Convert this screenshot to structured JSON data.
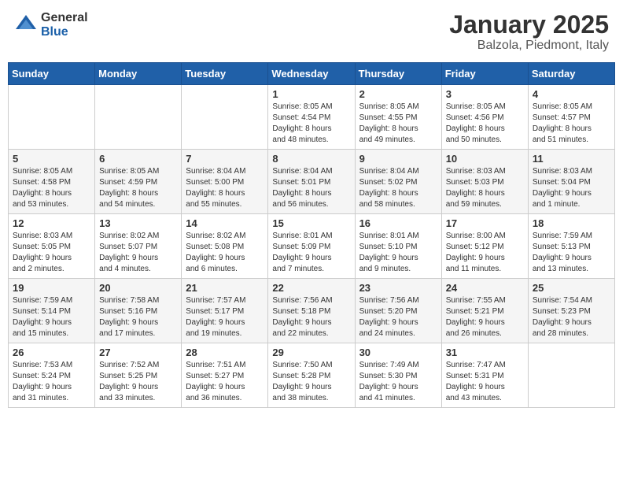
{
  "header": {
    "logo_general": "General",
    "logo_blue": "Blue",
    "month_title": "January 2025",
    "location": "Balzola, Piedmont, Italy"
  },
  "weekdays": [
    "Sunday",
    "Monday",
    "Tuesday",
    "Wednesday",
    "Thursday",
    "Friday",
    "Saturday"
  ],
  "weeks": [
    [
      {
        "day": "",
        "info": ""
      },
      {
        "day": "",
        "info": ""
      },
      {
        "day": "",
        "info": ""
      },
      {
        "day": "1",
        "info": "Sunrise: 8:05 AM\nSunset: 4:54 PM\nDaylight: 8 hours\nand 48 minutes."
      },
      {
        "day": "2",
        "info": "Sunrise: 8:05 AM\nSunset: 4:55 PM\nDaylight: 8 hours\nand 49 minutes."
      },
      {
        "day": "3",
        "info": "Sunrise: 8:05 AM\nSunset: 4:56 PM\nDaylight: 8 hours\nand 50 minutes."
      },
      {
        "day": "4",
        "info": "Sunrise: 8:05 AM\nSunset: 4:57 PM\nDaylight: 8 hours\nand 51 minutes."
      }
    ],
    [
      {
        "day": "5",
        "info": "Sunrise: 8:05 AM\nSunset: 4:58 PM\nDaylight: 8 hours\nand 53 minutes."
      },
      {
        "day": "6",
        "info": "Sunrise: 8:05 AM\nSunset: 4:59 PM\nDaylight: 8 hours\nand 54 minutes."
      },
      {
        "day": "7",
        "info": "Sunrise: 8:04 AM\nSunset: 5:00 PM\nDaylight: 8 hours\nand 55 minutes."
      },
      {
        "day": "8",
        "info": "Sunrise: 8:04 AM\nSunset: 5:01 PM\nDaylight: 8 hours\nand 56 minutes."
      },
      {
        "day": "9",
        "info": "Sunrise: 8:04 AM\nSunset: 5:02 PM\nDaylight: 8 hours\nand 58 minutes."
      },
      {
        "day": "10",
        "info": "Sunrise: 8:03 AM\nSunset: 5:03 PM\nDaylight: 8 hours\nand 59 minutes."
      },
      {
        "day": "11",
        "info": "Sunrise: 8:03 AM\nSunset: 5:04 PM\nDaylight: 9 hours\nand 1 minute."
      }
    ],
    [
      {
        "day": "12",
        "info": "Sunrise: 8:03 AM\nSunset: 5:05 PM\nDaylight: 9 hours\nand 2 minutes."
      },
      {
        "day": "13",
        "info": "Sunrise: 8:02 AM\nSunset: 5:07 PM\nDaylight: 9 hours\nand 4 minutes."
      },
      {
        "day": "14",
        "info": "Sunrise: 8:02 AM\nSunset: 5:08 PM\nDaylight: 9 hours\nand 6 minutes."
      },
      {
        "day": "15",
        "info": "Sunrise: 8:01 AM\nSunset: 5:09 PM\nDaylight: 9 hours\nand 7 minutes."
      },
      {
        "day": "16",
        "info": "Sunrise: 8:01 AM\nSunset: 5:10 PM\nDaylight: 9 hours\nand 9 minutes."
      },
      {
        "day": "17",
        "info": "Sunrise: 8:00 AM\nSunset: 5:12 PM\nDaylight: 9 hours\nand 11 minutes."
      },
      {
        "day": "18",
        "info": "Sunrise: 7:59 AM\nSunset: 5:13 PM\nDaylight: 9 hours\nand 13 minutes."
      }
    ],
    [
      {
        "day": "19",
        "info": "Sunrise: 7:59 AM\nSunset: 5:14 PM\nDaylight: 9 hours\nand 15 minutes."
      },
      {
        "day": "20",
        "info": "Sunrise: 7:58 AM\nSunset: 5:16 PM\nDaylight: 9 hours\nand 17 minutes."
      },
      {
        "day": "21",
        "info": "Sunrise: 7:57 AM\nSunset: 5:17 PM\nDaylight: 9 hours\nand 19 minutes."
      },
      {
        "day": "22",
        "info": "Sunrise: 7:56 AM\nSunset: 5:18 PM\nDaylight: 9 hours\nand 22 minutes."
      },
      {
        "day": "23",
        "info": "Sunrise: 7:56 AM\nSunset: 5:20 PM\nDaylight: 9 hours\nand 24 minutes."
      },
      {
        "day": "24",
        "info": "Sunrise: 7:55 AM\nSunset: 5:21 PM\nDaylight: 9 hours\nand 26 minutes."
      },
      {
        "day": "25",
        "info": "Sunrise: 7:54 AM\nSunset: 5:23 PM\nDaylight: 9 hours\nand 28 minutes."
      }
    ],
    [
      {
        "day": "26",
        "info": "Sunrise: 7:53 AM\nSunset: 5:24 PM\nDaylight: 9 hours\nand 31 minutes."
      },
      {
        "day": "27",
        "info": "Sunrise: 7:52 AM\nSunset: 5:25 PM\nDaylight: 9 hours\nand 33 minutes."
      },
      {
        "day": "28",
        "info": "Sunrise: 7:51 AM\nSunset: 5:27 PM\nDaylight: 9 hours\nand 36 minutes."
      },
      {
        "day": "29",
        "info": "Sunrise: 7:50 AM\nSunset: 5:28 PM\nDaylight: 9 hours\nand 38 minutes."
      },
      {
        "day": "30",
        "info": "Sunrise: 7:49 AM\nSunset: 5:30 PM\nDaylight: 9 hours\nand 41 minutes."
      },
      {
        "day": "31",
        "info": "Sunrise: 7:47 AM\nSunset: 5:31 PM\nDaylight: 9 hours\nand 43 minutes."
      },
      {
        "day": "",
        "info": ""
      }
    ]
  ]
}
